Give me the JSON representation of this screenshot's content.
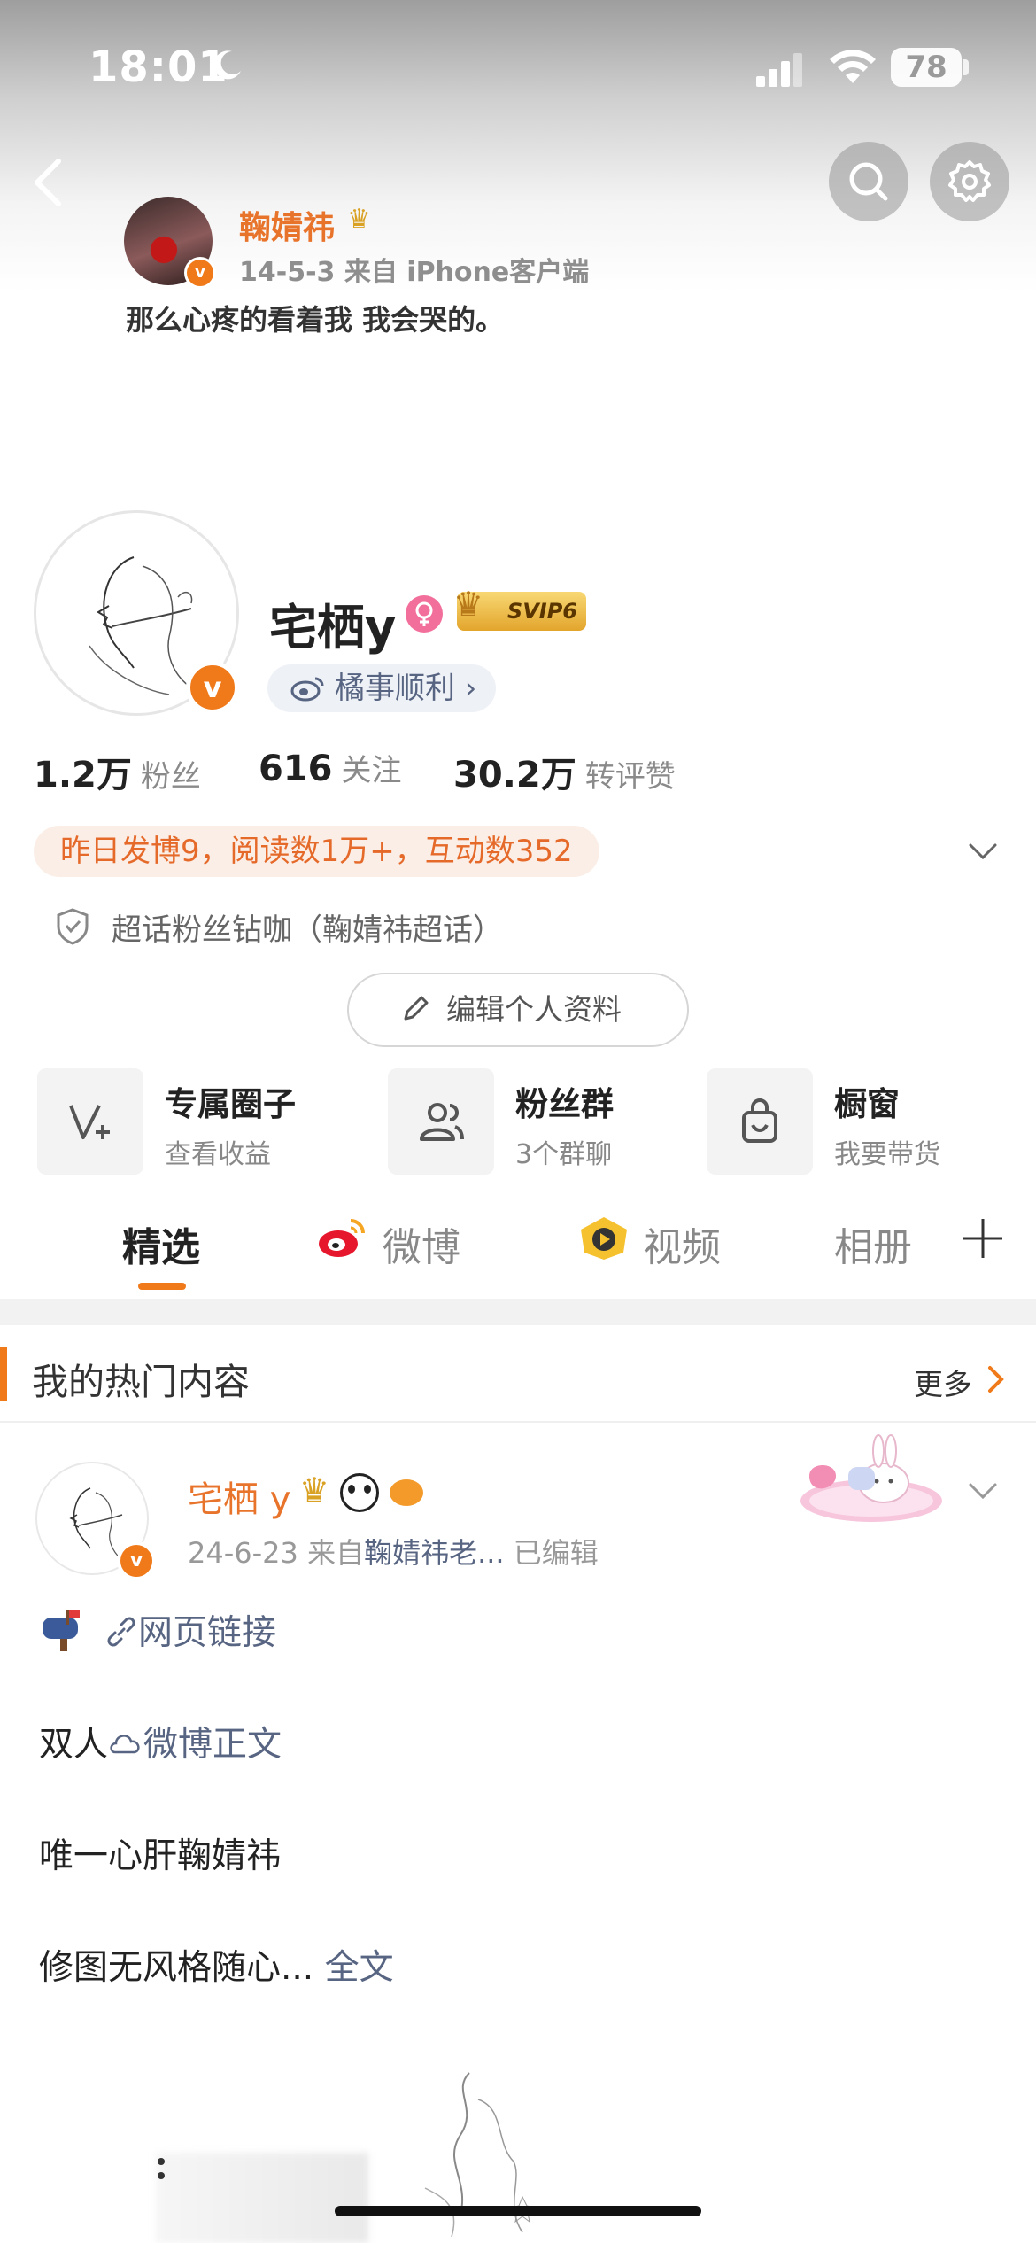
{
  "status_bar": {
    "time": "18:01",
    "battery": "78"
  },
  "background_post": {
    "username": "鞠婧祎",
    "meta": "14-5-3  来自 iPhone客户端",
    "text": "那么心疼的看着我  我会哭的。"
  },
  "profile": {
    "nickname": "宅栖y",
    "svip": "SVIP6",
    "weibo_tag": "橘事顺利",
    "stats": [
      {
        "value": "1.2万",
        "label": "粉丝"
      },
      {
        "value": "616",
        "label": "关注"
      },
      {
        "value": "30.2万",
        "label": "转评赞"
      }
    ],
    "yesterday": "昨日发博9，阅读数1万+，互动数352",
    "supertopic": "超话粉丝钻咖（鞠婧祎超话）",
    "edit_button": "编辑个人资料"
  },
  "features": [
    {
      "title": "专属圈子",
      "subtitle": "查看收益"
    },
    {
      "title": "粉丝群",
      "subtitle": "3个群聊"
    },
    {
      "title": "橱窗",
      "subtitle": "我要带货"
    }
  ],
  "tabs": [
    "精选",
    "微博",
    "视频",
    "相册"
  ],
  "hot_section": {
    "title": "我的热门内容",
    "more": "更多"
  },
  "post": {
    "name": "宅栖 y",
    "date": "24-6-23",
    "from_prefix": "来自",
    "source": "鞠婧祎老...",
    "edited": "已编辑",
    "link_text": "网页链接",
    "line1_prefix": "双人",
    "line1_link": "微博正文",
    "line2": "唯一心肝鞠婧祎",
    "line3": "修图无风格随心...",
    "full_text": "全文"
  },
  "colors": {
    "accent": "#f07a1a",
    "link": "#586582",
    "name_orange": "#e8742c"
  }
}
